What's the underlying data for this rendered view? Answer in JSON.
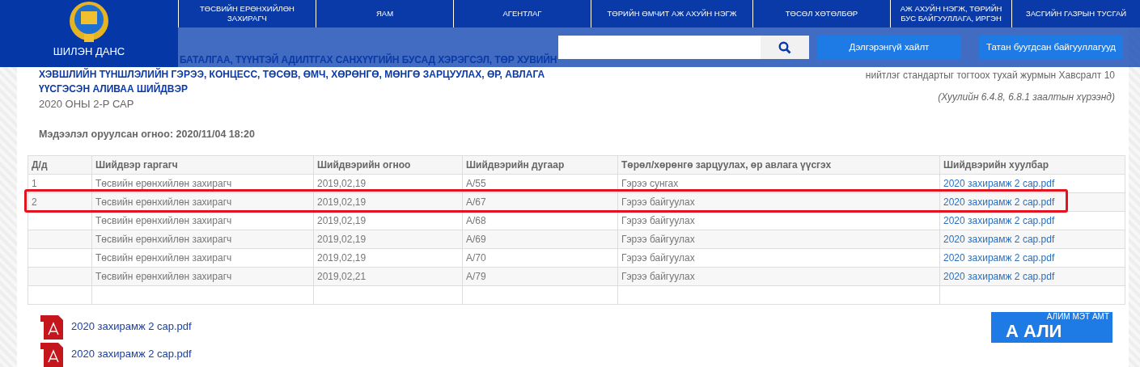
{
  "logo": {
    "caption": "ШИЛЭН ДАНС"
  },
  "nav": [
    {
      "label": "ТӨСВИЙН ЕРӨНХИЙЛӨН ЗАХИРАГЧ"
    },
    {
      "label": "ЯАМ"
    },
    {
      "label": "АГЕНТЛАГ"
    },
    {
      "label": "ТӨРИЙН ӨМЧИТ АЖ АХУЙН НЭГЖ"
    },
    {
      "label": "ТӨСӨЛ ХӨТӨЛБӨР"
    },
    {
      "label": "АЖ АХУЙН НЭГЖ, ТӨРИЙН БУС БАЙГУУЛЛАГА, ИРГЭН"
    },
    {
      "label": "ЗАСГИЙН ГАЗРЫН ТУСГАЙ"
    }
  ],
  "search": {
    "buttons": [
      "Дэлгэрэнгүй хайлт",
      "Татан буугдсан байгууллагууд"
    ]
  },
  "title_lines": [
    "БАТАЛГАА, ТҮҮНТЭЙ АДИЛТГАХ САНХҮҮГИЙН БУСАД ХЭРЭГСЭЛ, ТӨР ХУВИЙН",
    "ХЭВШЛИЙН ТҮНШЛЭЛИЙН ГЭРЭЭ, КОНЦЕСС, ТӨСӨВ, ӨМЧ, ХӨРӨНГӨ, МӨНГӨ ЗАРЦУУЛАХ, ӨР, АВЛАГА",
    "ҮҮСГЭСЭН АЛИВАА ШИЙДВЭР"
  ],
  "period": "2020 ОНЫ 2-Р САР",
  "updated": "Мэдээлэл оруулсан огноо: 2020/11/04 18:20",
  "reference": {
    "standard": "нийтлэг стандартыг тогтоох тухай журмын Хавсралт 10",
    "law": "(Хуулийн 6.4.8, 6.8.1 заалтын хүрээнд)"
  },
  "table": {
    "columns": [
      "Д/д",
      "Шийдвэр гаргагч",
      "Шийдвэрийн огноо",
      "Шийдвэрийн дугаар",
      "Төрөл/хөрөнгө зарцуулах, өр авлага үүсгэх",
      "Шийдвэрийн хуулбар"
    ],
    "rows": [
      {
        "cells": [
          "1",
          "Төсвийн ерөнхийлөн захирагч",
          "2019,02,19",
          "А/55",
          "Гэрээ сунгах",
          "2020 захирамж 2 сар.pdf"
        ],
        "highlighted": false
      },
      {
        "cells": [
          "2",
          "Төсвийн ерөнхийлөн захирагч",
          "2019,02,19",
          "А/67",
          "Гэрээ байгуулах",
          "2020 захирамж 2 сар.pdf"
        ],
        "highlighted": true
      },
      {
        "cells": [
          "",
          "Төсвийн ерөнхийлөн захирагч",
          "2019,02,19",
          "А/68",
          "Гэрээ байгуулах",
          "2020 захирамж 2 сар.pdf"
        ],
        "highlighted": false
      },
      {
        "cells": [
          "",
          "Төсвийн ерөнхийлөн захирагч",
          "2019,02,19",
          "А/69",
          "Гэрээ байгуулах",
          "2020 захирамж 2 сар.pdf"
        ],
        "highlighted": false
      },
      {
        "cells": [
          "",
          "Төсвийн ерөнхийлөн захирагч",
          "2019,02,19",
          "А/70",
          "Гэрээ байгуулах",
          "2020 захирамж 2 сар.pdf"
        ],
        "highlighted": false
      },
      {
        "cells": [
          "",
          "Төсвийн ерөнхийлөн захирагч",
          "2019,02,21",
          "А/79",
          "Гэрээ байгуулах",
          "2020 захирамж 2 сар.pdf"
        ],
        "highlighted": false
      },
      {
        "cells": [
          "",
          "",
          "",
          "",
          "",
          ""
        ],
        "highlighted": false
      }
    ]
  },
  "attachments": [
    {
      "name": "2020 захирамж 2 сар.pdf"
    },
    {
      "name": "2020 захирамж 2 сар.pdf"
    }
  ],
  "widget": {
    "caption": "АЛИМ МЭТ АМТ",
    "big": "А АЛИ"
  }
}
